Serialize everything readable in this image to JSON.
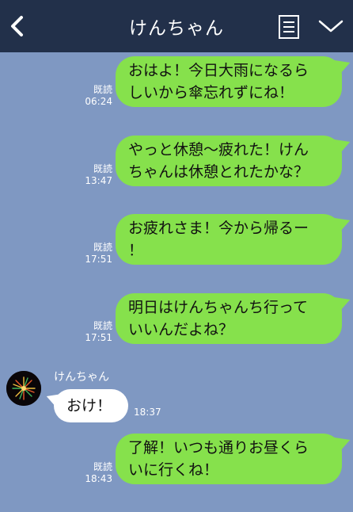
{
  "header": {
    "title": "けんちゃん"
  },
  "messages": [
    {
      "lines": [
        "おはよ！今日大雨になるら",
        "しいから傘忘れずにね！"
      ],
      "read": "既読",
      "time": "06:24"
    },
    {
      "lines": [
        "やっと休憩〜疲れた！けん",
        "ちゃんは休憩とれたかな？"
      ],
      "read": "既読",
      "time": "13:47"
    },
    {
      "lines": [
        "お疲れさま！今から帰るー",
        "！"
      ],
      "read": "既読",
      "time": "17:51"
    },
    {
      "lines": [
        "明日はけんちゃんち行って",
        "いいんだよね？"
      ],
      "read": "既読",
      "time": "17:51"
    },
    {
      "sender": "けんちゃん",
      "lines": [
        "おけ！"
      ],
      "time": "18:37"
    },
    {
      "lines": [
        "了解！いつも通りお昼くら",
        "いに行くね！"
      ],
      "read": "既読",
      "time": "18:43"
    }
  ],
  "colors": {
    "header_bg": "#22304a",
    "chat_bg": "#7f98c2",
    "outgoing_bubble": "#86e14c",
    "incoming_bubble": "#ffffff"
  },
  "icons": [
    "back-chevron-icon",
    "menu-list-icon",
    "chevron-down-icon",
    "avatar-fireworks-icon"
  ]
}
